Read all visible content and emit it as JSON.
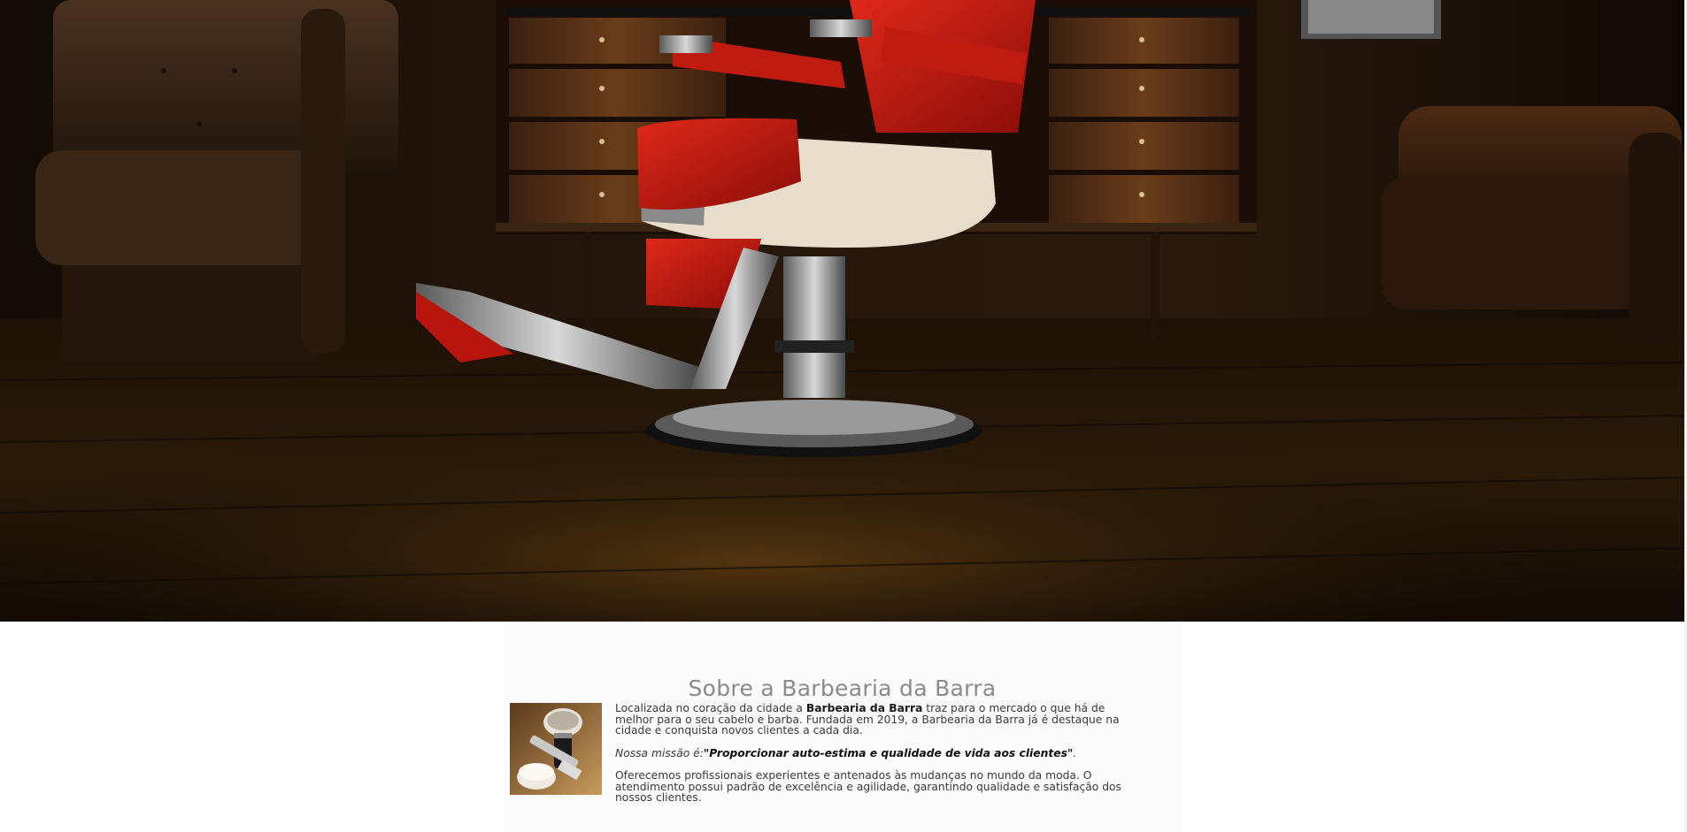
{
  "about": {
    "title": "Sobre a Barbearia da Barra",
    "paragraph1": {
      "before": "Localizada no coração da cidade a ",
      "brand": "Barbearia da Barra",
      "after": " traz para o mercado o que há de melhor para o seu cabelo e barba. Fundada em 2019, a Barbearia da Barra já é destaque na cidade e conquista novos clientes a cada dia."
    },
    "mission": {
      "label": "Nossa missão é:",
      "quote": "\"Proporcionar auto-estima e qualidade de vida aos clientes\"",
      "end": "."
    },
    "paragraph3": "Oferecemos profissionais experientes e antenados às mudanças no mundo da moda. O atendimento possui padrão de excelência e agilidade, garantindo qualidade e satisfação dos nossos clientes."
  },
  "colors": {
    "chair_red": "#c21a12",
    "title_gray": "#8a8a8a",
    "text_dark": "#3a3a3a"
  }
}
